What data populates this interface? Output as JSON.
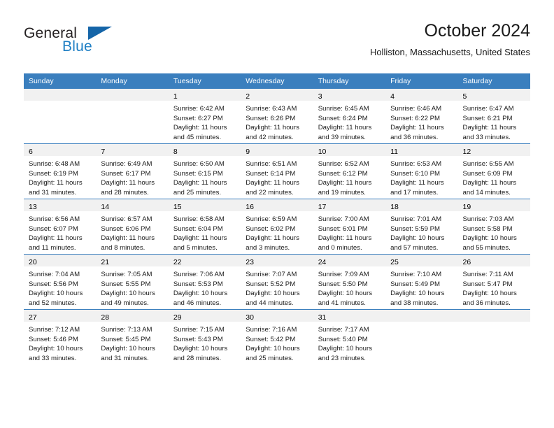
{
  "brand": {
    "name_top": "General",
    "name_bottom": "Blue",
    "accent_color": "#1f7fc4",
    "triangle_color": "#1565a8"
  },
  "header": {
    "title": "October 2024",
    "subtitle": "Holliston, Massachusetts, United States"
  },
  "theme": {
    "header_bg": "#3b7fbe",
    "header_text": "#ffffff",
    "daynum_band_bg": "#f1f1f1",
    "row_separator": "#3b7fbe",
    "body_text": "#1a1a1a"
  },
  "weekday_headers": [
    "Sunday",
    "Monday",
    "Tuesday",
    "Wednesday",
    "Thursday",
    "Friday",
    "Saturday"
  ],
  "weeks": [
    [
      {
        "day": "",
        "lines": []
      },
      {
        "day": "",
        "lines": []
      },
      {
        "day": "1",
        "lines": [
          "Sunrise: 6:42 AM",
          "Sunset: 6:27 PM",
          "Daylight: 11 hours",
          "and 45 minutes."
        ]
      },
      {
        "day": "2",
        "lines": [
          "Sunrise: 6:43 AM",
          "Sunset: 6:26 PM",
          "Daylight: 11 hours",
          "and 42 minutes."
        ]
      },
      {
        "day": "3",
        "lines": [
          "Sunrise: 6:45 AM",
          "Sunset: 6:24 PM",
          "Daylight: 11 hours",
          "and 39 minutes."
        ]
      },
      {
        "day": "4",
        "lines": [
          "Sunrise: 6:46 AM",
          "Sunset: 6:22 PM",
          "Daylight: 11 hours",
          "and 36 minutes."
        ]
      },
      {
        "day": "5",
        "lines": [
          "Sunrise: 6:47 AM",
          "Sunset: 6:21 PM",
          "Daylight: 11 hours",
          "and 33 minutes."
        ]
      }
    ],
    [
      {
        "day": "6",
        "lines": [
          "Sunrise: 6:48 AM",
          "Sunset: 6:19 PM",
          "Daylight: 11 hours",
          "and 31 minutes."
        ]
      },
      {
        "day": "7",
        "lines": [
          "Sunrise: 6:49 AM",
          "Sunset: 6:17 PM",
          "Daylight: 11 hours",
          "and 28 minutes."
        ]
      },
      {
        "day": "8",
        "lines": [
          "Sunrise: 6:50 AM",
          "Sunset: 6:15 PM",
          "Daylight: 11 hours",
          "and 25 minutes."
        ]
      },
      {
        "day": "9",
        "lines": [
          "Sunrise: 6:51 AM",
          "Sunset: 6:14 PM",
          "Daylight: 11 hours",
          "and 22 minutes."
        ]
      },
      {
        "day": "10",
        "lines": [
          "Sunrise: 6:52 AM",
          "Sunset: 6:12 PM",
          "Daylight: 11 hours",
          "and 19 minutes."
        ]
      },
      {
        "day": "11",
        "lines": [
          "Sunrise: 6:53 AM",
          "Sunset: 6:10 PM",
          "Daylight: 11 hours",
          "and 17 minutes."
        ]
      },
      {
        "day": "12",
        "lines": [
          "Sunrise: 6:55 AM",
          "Sunset: 6:09 PM",
          "Daylight: 11 hours",
          "and 14 minutes."
        ]
      }
    ],
    [
      {
        "day": "13",
        "lines": [
          "Sunrise: 6:56 AM",
          "Sunset: 6:07 PM",
          "Daylight: 11 hours",
          "and 11 minutes."
        ]
      },
      {
        "day": "14",
        "lines": [
          "Sunrise: 6:57 AM",
          "Sunset: 6:06 PM",
          "Daylight: 11 hours",
          "and 8 minutes."
        ]
      },
      {
        "day": "15",
        "lines": [
          "Sunrise: 6:58 AM",
          "Sunset: 6:04 PM",
          "Daylight: 11 hours",
          "and 5 minutes."
        ]
      },
      {
        "day": "16",
        "lines": [
          "Sunrise: 6:59 AM",
          "Sunset: 6:02 PM",
          "Daylight: 11 hours",
          "and 3 minutes."
        ]
      },
      {
        "day": "17",
        "lines": [
          "Sunrise: 7:00 AM",
          "Sunset: 6:01 PM",
          "Daylight: 11 hours",
          "and 0 minutes."
        ]
      },
      {
        "day": "18",
        "lines": [
          "Sunrise: 7:01 AM",
          "Sunset: 5:59 PM",
          "Daylight: 10 hours",
          "and 57 minutes."
        ]
      },
      {
        "day": "19",
        "lines": [
          "Sunrise: 7:03 AM",
          "Sunset: 5:58 PM",
          "Daylight: 10 hours",
          "and 55 minutes."
        ]
      }
    ],
    [
      {
        "day": "20",
        "lines": [
          "Sunrise: 7:04 AM",
          "Sunset: 5:56 PM",
          "Daylight: 10 hours",
          "and 52 minutes."
        ]
      },
      {
        "day": "21",
        "lines": [
          "Sunrise: 7:05 AM",
          "Sunset: 5:55 PM",
          "Daylight: 10 hours",
          "and 49 minutes."
        ]
      },
      {
        "day": "22",
        "lines": [
          "Sunrise: 7:06 AM",
          "Sunset: 5:53 PM",
          "Daylight: 10 hours",
          "and 46 minutes."
        ]
      },
      {
        "day": "23",
        "lines": [
          "Sunrise: 7:07 AM",
          "Sunset: 5:52 PM",
          "Daylight: 10 hours",
          "and 44 minutes."
        ]
      },
      {
        "day": "24",
        "lines": [
          "Sunrise: 7:09 AM",
          "Sunset: 5:50 PM",
          "Daylight: 10 hours",
          "and 41 minutes."
        ]
      },
      {
        "day": "25",
        "lines": [
          "Sunrise: 7:10 AM",
          "Sunset: 5:49 PM",
          "Daylight: 10 hours",
          "and 38 minutes."
        ]
      },
      {
        "day": "26",
        "lines": [
          "Sunrise: 7:11 AM",
          "Sunset: 5:47 PM",
          "Daylight: 10 hours",
          "and 36 minutes."
        ]
      }
    ],
    [
      {
        "day": "27",
        "lines": [
          "Sunrise: 7:12 AM",
          "Sunset: 5:46 PM",
          "Daylight: 10 hours",
          "and 33 minutes."
        ]
      },
      {
        "day": "28",
        "lines": [
          "Sunrise: 7:13 AM",
          "Sunset: 5:45 PM",
          "Daylight: 10 hours",
          "and 31 minutes."
        ]
      },
      {
        "day": "29",
        "lines": [
          "Sunrise: 7:15 AM",
          "Sunset: 5:43 PM",
          "Daylight: 10 hours",
          "and 28 minutes."
        ]
      },
      {
        "day": "30",
        "lines": [
          "Sunrise: 7:16 AM",
          "Sunset: 5:42 PM",
          "Daylight: 10 hours",
          "and 25 minutes."
        ]
      },
      {
        "day": "31",
        "lines": [
          "Sunrise: 7:17 AM",
          "Sunset: 5:40 PM",
          "Daylight: 10 hours",
          "and 23 minutes."
        ]
      },
      {
        "day": "",
        "lines": []
      },
      {
        "day": "",
        "lines": []
      }
    ]
  ]
}
